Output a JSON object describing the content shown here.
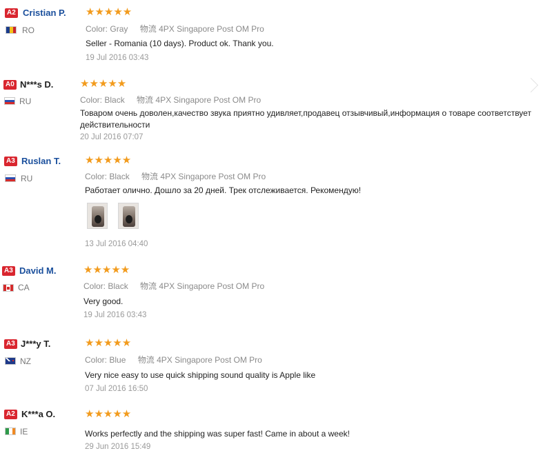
{
  "labels": {
    "color_prefix": "Color:",
    "shipping_prefix": "物流"
  },
  "reviews": [
    {
      "level": "A2",
      "name": "Cristian P.",
      "country": "RO",
      "flag": "romania-flag",
      "rating": 5,
      "stars": "★★★★★",
      "color": "Gray",
      "shipping": "4PX Singapore Post OM Pro",
      "text": "Seller - Romania (10 days). Product ok. Thank you.",
      "date": "19 Jul 2016 03:43"
    },
    {
      "level": "A0",
      "name": "N***s D.",
      "country": "RU",
      "flag": "russia-flag",
      "rating": 5,
      "stars": "★★★★★",
      "color": "Black",
      "shipping": "4PX Singapore Post OM Pro",
      "text": "Товаром очень доволен,качество звука приятно удивляет,продавец отзывчивый,информация о товаре соответствует действительности",
      "date": "20 Jul 2016 07:07"
    },
    {
      "level": "A3",
      "name": "Ruslan T.",
      "country": "RU",
      "flag": "russia-flag",
      "rating": 5,
      "stars": "★★★★★",
      "color": "Black",
      "shipping": "4PX Singapore Post OM Pro",
      "text": "Работает оличнo. Дошло за 20 дней. Трек отслеживается. Рекомендую!",
      "photos": [
        "earbud-photo-1",
        "earbud-photo-2"
      ],
      "date": "13 Jul 2016 04:40"
    },
    {
      "level": "A3",
      "name": "David M.",
      "country": "CA",
      "flag": "canada-flag",
      "rating": 5,
      "stars": "★★★★★",
      "color": "Black",
      "shipping": "4PX Singapore Post OM Pro",
      "text": "Very good.",
      "date": "19 Jul 2016 03:43"
    },
    {
      "level": "A3",
      "name": "J***y T.",
      "country": "NZ",
      "flag": "new-zealand-flag",
      "rating": 5,
      "stars": "★★★★★",
      "color": "Blue",
      "shipping": "4PX Singapore Post OM Pro",
      "text": "Very nice easy to use quick shipping sound quality is Apple like",
      "date": "07 Jul 2016 16:50"
    },
    {
      "level": "A2",
      "name": "K***a O.",
      "country": "IE",
      "flag": "ireland-flag",
      "rating": 5,
      "stars": "★★★★★",
      "color": "",
      "shipping": "",
      "text": "Works perfectly and the shipping was super fast! Came in about a week!",
      "date": "29 Jun 2016 15:49"
    }
  ],
  "colors": {
    "badge": "#d9262f",
    "name_link": "#1a4f9c",
    "star": "#f29b1d"
  }
}
